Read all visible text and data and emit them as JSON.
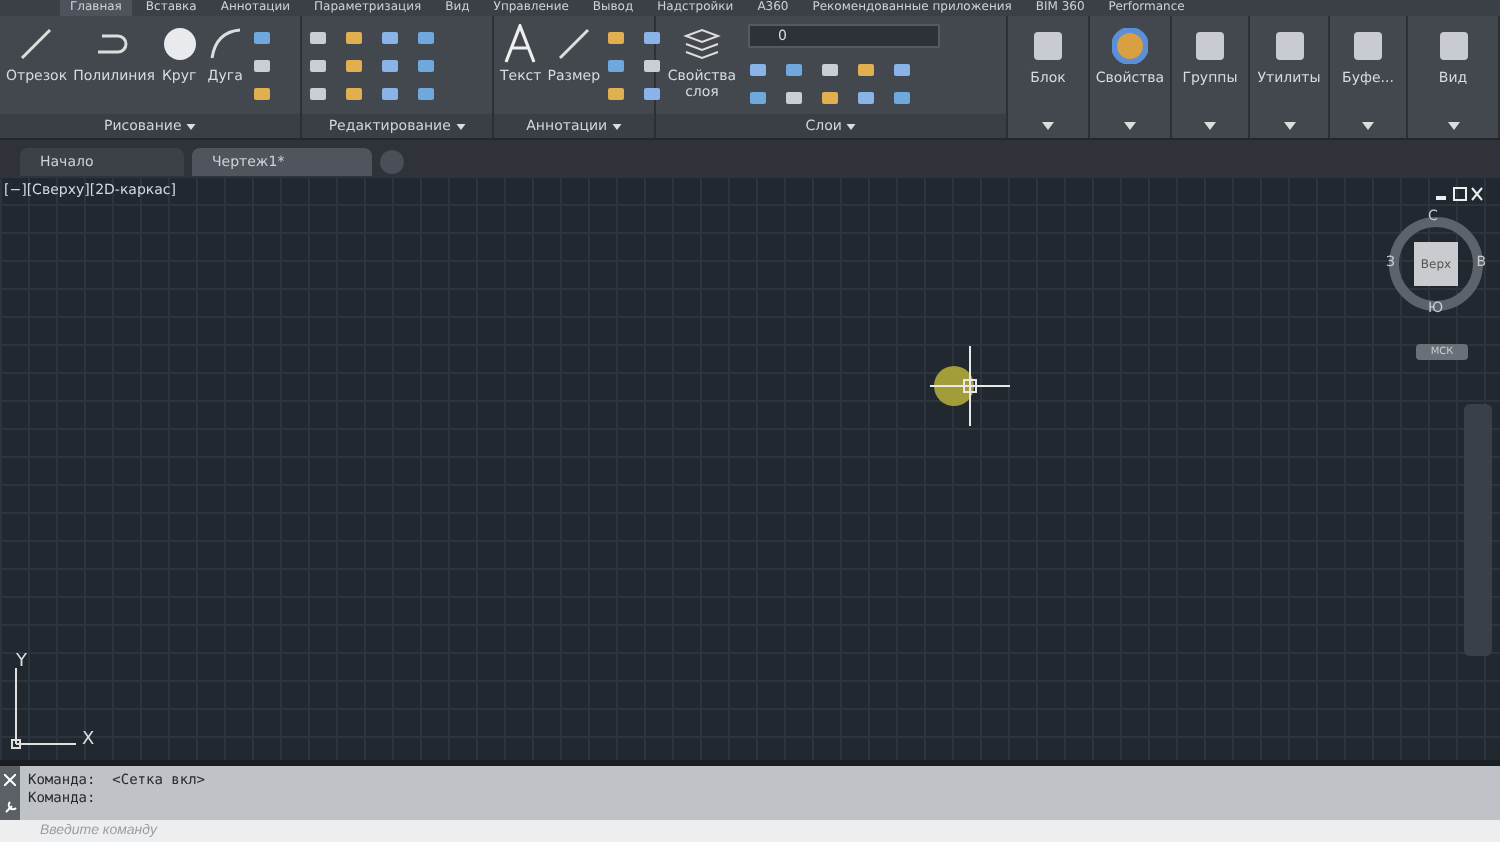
{
  "ribbon_tabs": [
    {
      "label": "Главная",
      "selected": true
    },
    {
      "label": "Вставка",
      "selected": false
    },
    {
      "label": "Аннотации",
      "selected": false
    },
    {
      "label": "Параметризация",
      "selected": false
    },
    {
      "label": "Вид",
      "selected": false
    },
    {
      "label": "Управление",
      "selected": false
    },
    {
      "label": "Вывод",
      "selected": false
    },
    {
      "label": "Надстройки",
      "selected": false
    },
    {
      "label": "A360",
      "selected": false
    },
    {
      "label": "Рекомендованные приложения",
      "selected": false
    },
    {
      "label": "BIM 360",
      "selected": false
    },
    {
      "label": "Performance",
      "selected": false
    }
  ],
  "panels": [
    {
      "kind": "group",
      "title": "Рисование",
      "tools": [
        "Отрезок",
        "Полилиния",
        "Круг",
        "Дуга"
      ]
    },
    {
      "kind": "group",
      "title": "Редактирование"
    },
    {
      "kind": "group",
      "title": "Аннотации",
      "tools": [
        "Текст",
        "Размер"
      ]
    },
    {
      "kind": "layers",
      "title": "Слои",
      "tools": [
        "Свойства слоя"
      ],
      "layer_value": "0"
    },
    {
      "kind": "single",
      "title": "Блок"
    },
    {
      "kind": "single",
      "title": "Свойства"
    },
    {
      "kind": "single",
      "title": "Группы"
    },
    {
      "kind": "single",
      "title": "Утилиты"
    },
    {
      "kind": "single",
      "title": "Буфе..."
    },
    {
      "kind": "single",
      "title": "Вид"
    }
  ],
  "doc_tabs": [
    {
      "label": "Начало",
      "selected": false
    },
    {
      "label": "Чертеж1*",
      "selected": true
    }
  ],
  "viewport": {
    "label": "[−][Сверху][2D-каркас]",
    "viewcube": {
      "north": "С",
      "west": "З",
      "east": "В",
      "south": "Ю",
      "face": "Верх",
      "ucs": "МСК"
    },
    "axis_x": "X",
    "axis_y": "Y"
  },
  "command_line": {
    "history": [
      "Команда:  <Сетка вкл>",
      "Команда:"
    ],
    "placeholder": "Введите команду"
  }
}
